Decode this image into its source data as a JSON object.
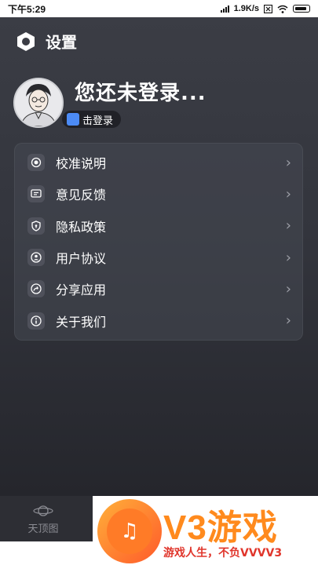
{
  "status_bar": {
    "time": "下午5:29",
    "network_speed": "1.9K/s",
    "icons": [
      "signal-icon",
      "close-box-icon",
      "wifi-icon",
      "battery-icon"
    ]
  },
  "header": {
    "title": "设置",
    "icon": "hexagon-gear-icon"
  },
  "profile": {
    "name": "您还未登录...",
    "login_button": "击登录",
    "avatar_icon": "person-avatar-icon"
  },
  "menu": {
    "items": [
      {
        "label": "校准说明",
        "icon": "target-icon"
      },
      {
        "label": "意见反馈",
        "icon": "chat-icon"
      },
      {
        "label": "隐私政策",
        "icon": "lock-icon"
      },
      {
        "label": "用户协议",
        "icon": "user-icon"
      },
      {
        "label": "分享应用",
        "icon": "share-icon"
      },
      {
        "label": "关于我们",
        "icon": "info-icon"
      }
    ],
    "chevron": "›"
  },
  "tabbar": {
    "tab1_label": "天顶图"
  },
  "watermark": {
    "title": "V3游戏",
    "subtitle": "游戏人生，不负VVVV3"
  },
  "colors": {
    "background": "#33353d",
    "accent": "#4c8bf5",
    "watermark_orange": "#ff8a1d"
  }
}
